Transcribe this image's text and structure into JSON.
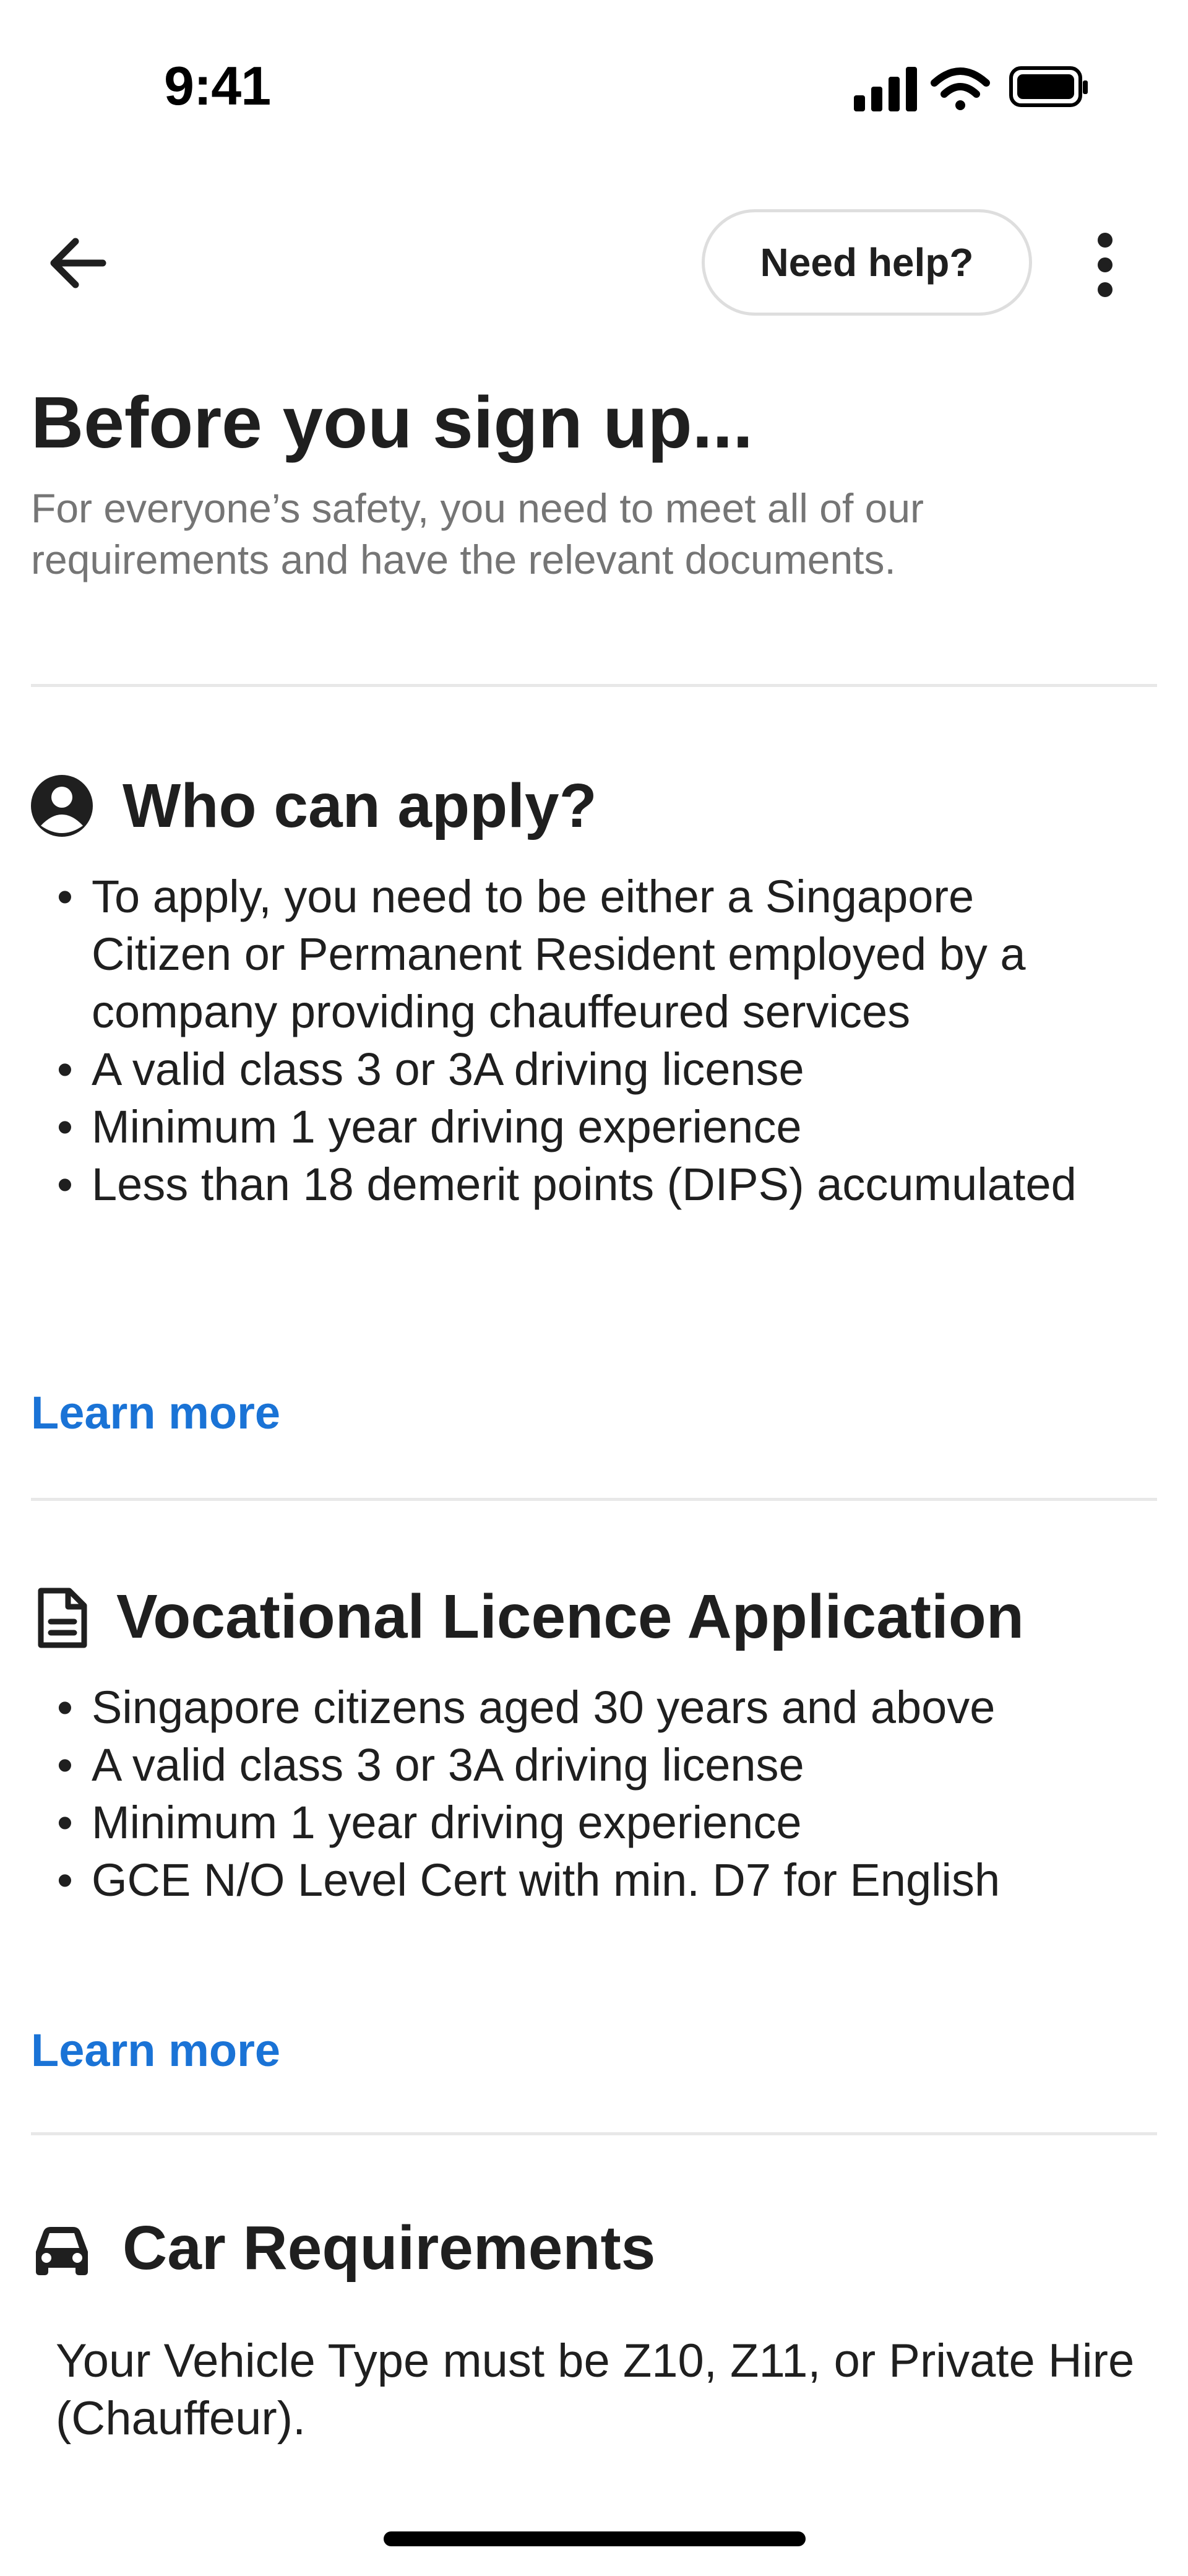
{
  "status_bar": {
    "time": "9:41",
    "icons": [
      "cellular-signal-icon",
      "wifi-icon",
      "battery-icon"
    ]
  },
  "nav": {
    "back_icon": "arrow-left-icon",
    "help_label": "Need help?",
    "more_icon": "more-vertical-icon"
  },
  "header": {
    "title": "Before you sign up...",
    "subtitle": "For everyone’s safety, you need to meet all of our requirements and have the relevant documents."
  },
  "sections": [
    {
      "icon": "account-circle-icon",
      "title": "Who can apply?",
      "items": [
        "To apply, you need to be either a Singapore Citizen or Permanent Resident employed by a company providing chauffeured services",
        "A valid class 3 or 3A driving license",
        "Minimum 1 year driving experience",
        "Less than 18 demerit points (DIPS) accumulated"
      ],
      "link": "Learn more"
    },
    {
      "icon": "document-icon",
      "title": "Vocational Licence Application",
      "items": [
        "Singapore citizens aged 30 years and above",
        "A valid class 3 or 3A driving license",
        "Minimum 1 year driving experience",
        "GCE N/O Level Cert with min. D7 for English"
      ],
      "link": "Learn more"
    },
    {
      "icon": "car-icon",
      "title": "Car Requirements",
      "body": "Your Vehicle Type must be Z10, Z11, or Private Hire (Chauffeur)."
    }
  ],
  "colors": {
    "link": "#1a73d6",
    "subtitle": "#757575",
    "text": "#1f1f1f",
    "divider": "#e8e8e8"
  }
}
